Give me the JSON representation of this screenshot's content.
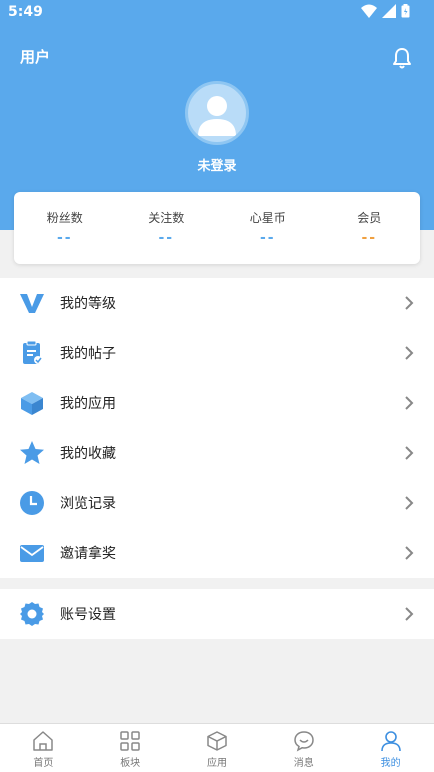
{
  "status_bar": {
    "time": "5:49"
  },
  "header": {
    "title": "用户",
    "login_status": "未登录"
  },
  "stats": [
    {
      "label": "粉丝数",
      "value": "--",
      "color": "#5aa9ec"
    },
    {
      "label": "关注数",
      "value": "--",
      "color": "#5aa9ec"
    },
    {
      "label": "心星币",
      "value": "--",
      "color": "#5aa9ec"
    },
    {
      "label": "会员",
      "value": "--",
      "color": "#f0a040"
    }
  ],
  "menu": [
    {
      "label": "我的等级",
      "icon": "v-level-icon"
    },
    {
      "label": "我的帖子",
      "icon": "clipboard-icon"
    },
    {
      "label": "我的应用",
      "icon": "cube-icon"
    },
    {
      "label": "我的收藏",
      "icon": "star-icon"
    },
    {
      "label": "浏览记录",
      "icon": "clock-icon"
    },
    {
      "label": "邀请拿奖",
      "icon": "envelope-icon"
    }
  ],
  "settings": {
    "label": "账号设置",
    "icon": "gear-icon"
  },
  "tabs": [
    {
      "label": "首页",
      "icon": "home-icon"
    },
    {
      "label": "板块",
      "icon": "grid-icon"
    },
    {
      "label": "应用",
      "icon": "box-icon"
    },
    {
      "label": "消息",
      "icon": "chat-icon"
    },
    {
      "label": "我的",
      "icon": "user-icon",
      "active": true
    }
  ],
  "colors": {
    "accent": "#5aa9ec",
    "tab_active": "#3d8fe0",
    "vip": "#f0a040"
  }
}
